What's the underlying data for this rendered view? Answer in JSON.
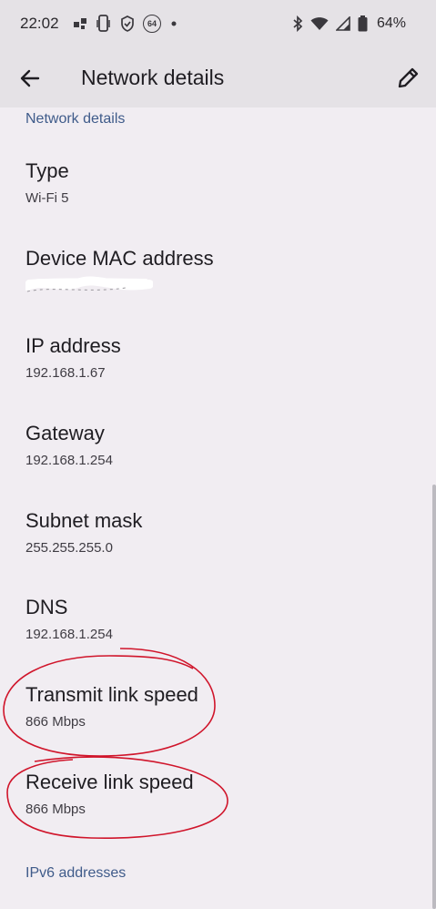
{
  "status_bar": {
    "time": "22:02",
    "left_icons": [
      "notification-icon",
      "phone-vibrate-icon",
      "shield-icon",
      "badge-64-icon",
      "dot-icon"
    ],
    "badge_text": "64",
    "right_icons": [
      "bluetooth-icon",
      "wifi-icon",
      "cell-signal-icon",
      "battery-icon"
    ],
    "battery_percent": "64%"
  },
  "app_bar": {
    "title": "Network details",
    "back_icon": "back-arrow-icon",
    "edit_icon": "pencil-icon"
  },
  "sections": {
    "network_details_header": "Network details",
    "ipv6_header": "IPv6 addresses"
  },
  "items": [
    {
      "title": "Type",
      "value": "Wi-Fi 5"
    },
    {
      "title": "Device MAC address",
      "value": ""
    },
    {
      "title": "IP address",
      "value": "192.168.1.67"
    },
    {
      "title": "Gateway",
      "value": "192.168.1.254"
    },
    {
      "title": "Subnet mask",
      "value": "255.255.255.0"
    },
    {
      "title": "DNS",
      "value": "192.168.1.254"
    },
    {
      "title": "Transmit link speed",
      "value": "866 Mbps"
    },
    {
      "title": "Receive link speed",
      "value": "866 Mbps"
    }
  ],
  "colors": {
    "background": "#f1edf2",
    "app_bar": "#e5e2e6",
    "section_header": "#3f5b8a",
    "annotation": "#d0152b"
  }
}
